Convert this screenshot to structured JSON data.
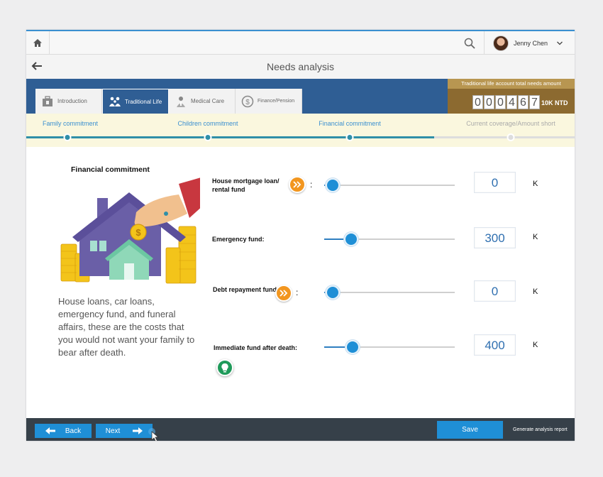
{
  "header": {
    "user_name": "Jenny Chen",
    "page_title": "Needs analysis"
  },
  "tabs": [
    {
      "label": "Introduction",
      "icon": "briefcase-icon",
      "active": false
    },
    {
      "label": "Traditional Life",
      "icon": "family-icon",
      "active": true
    },
    {
      "label": "Medical Care",
      "icon": "doctor-icon",
      "active": false
    },
    {
      "label": "Finance/Pension",
      "icon": "dollar-coin-icon",
      "active": false
    }
  ],
  "needs_total": {
    "title": "Traditional life account total needs amount",
    "digits": [
      "0",
      "0",
      "0",
      "4",
      "6",
      "7"
    ],
    "unit": "10K NTD"
  },
  "steps": [
    {
      "label": "Family commitment",
      "state": "done"
    },
    {
      "label": "Children commitment",
      "state": "done"
    },
    {
      "label": "Financial commitment",
      "state": "current"
    },
    {
      "label": "Current coverage/Amount short",
      "state": "future"
    }
  ],
  "section": {
    "title": "Financial commitment",
    "description": "House loans, car loans, emergency fund, and funeral affairs, these are the costs that you would not want your family to bear after death."
  },
  "funds": [
    {
      "label": "House mortgage loan/ rental fund",
      "value": "0",
      "unit": "K",
      "has_detail": true,
      "slider_fraction": 0.0
    },
    {
      "label": "Emergency fund:",
      "value": "300",
      "unit": "K",
      "has_detail": false,
      "slider_fraction": 0.15
    },
    {
      "label": "Debt repayment fund",
      "value": "0",
      "unit": "K",
      "has_detail": true,
      "slider_fraction": 0.0
    },
    {
      "label": "Immediate fund after death:",
      "value": "400",
      "unit": "K",
      "has_detail": false,
      "slider_fraction": 0.16
    }
  ],
  "colon": ":",
  "footer": {
    "back_label": "Back",
    "next_label": "Next",
    "save_label": "Save",
    "report_label": "Generate analysis report"
  },
  "colors": {
    "accent": "#1f8fd6",
    "bluebar": "#2f5e94",
    "progress_bg": "#faf7de",
    "step_line": "#2f8fa8",
    "footer": "#364049",
    "detail_button": "#f2961f",
    "tip_button": "#1f9a5a"
  }
}
